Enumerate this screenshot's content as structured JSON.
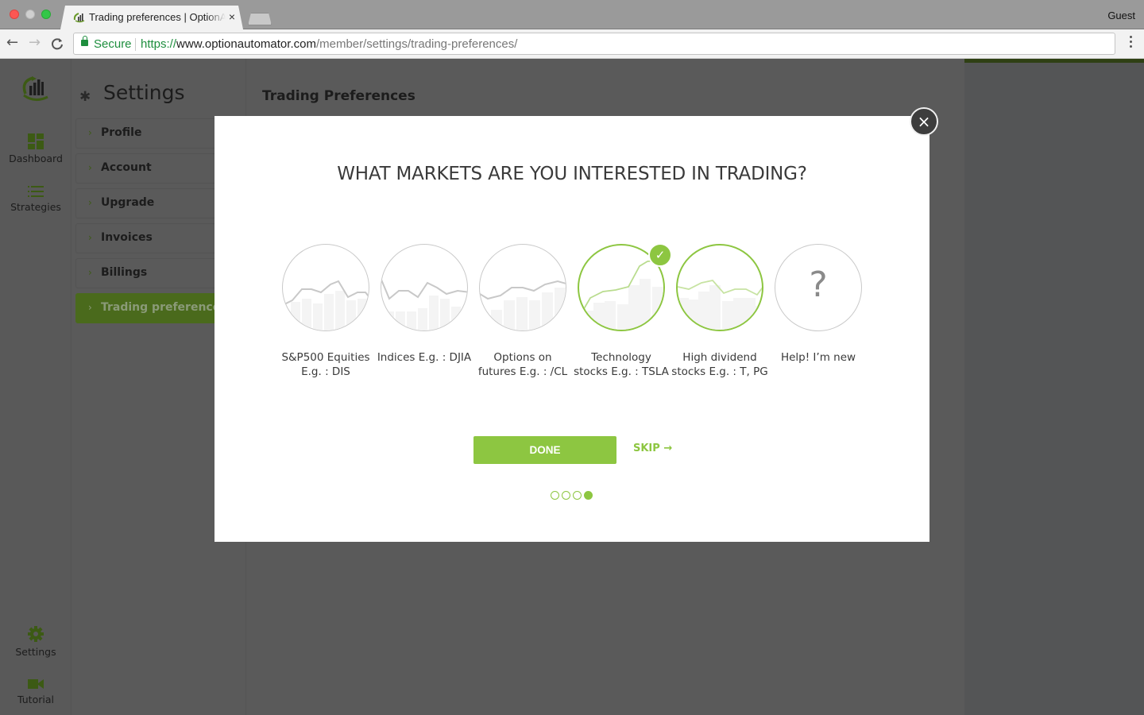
{
  "browser": {
    "tab_title": "Trading preferences | OptionAutomator",
    "tab_close": "×",
    "profile": "Guest",
    "secure_label": "Secure",
    "url": {
      "scheme": "https://",
      "host": "www.optionautomator.com",
      "path": "/member/settings/trading-preferences/"
    },
    "nav": {
      "back": "←",
      "forward": "→",
      "reload": "C"
    }
  },
  "left_nav": {
    "items": [
      {
        "label": "Dashboard",
        "icon": "dashboard-icon"
      },
      {
        "label": "Strategies",
        "icon": "list-icon"
      },
      {
        "label": "Settings",
        "icon": "gear-icon"
      },
      {
        "label": "Tutorial",
        "icon": "video-camera-icon"
      }
    ]
  },
  "settings": {
    "title": "Settings",
    "gear": "✱",
    "chevron": "›",
    "menu": [
      {
        "label": "Profile",
        "active": false
      },
      {
        "label": "Account",
        "active": false
      },
      {
        "label": "Upgrade",
        "active": false
      },
      {
        "label": "Invoices",
        "active": false
      },
      {
        "label": "Billings",
        "active": false
      },
      {
        "label": "Trading preferences",
        "active": true
      }
    ]
  },
  "main": {
    "title": "Trading Preferences"
  },
  "modal": {
    "close": "×",
    "title": "WHAT MARKETS ARE YOU INTERESTED IN TRADING?",
    "check": "✓",
    "help_symbol": "?",
    "markets": [
      {
        "line1": "S&P500 Equities",
        "line2": "E.g. : DIS",
        "selected": false
      },
      {
        "line1": "Indices E.g. : DJIA",
        "line2": "",
        "selected": false
      },
      {
        "line1": "Options on",
        "line2": "futures E.g. : /CL",
        "selected": false
      },
      {
        "line1": "Technology",
        "line2": "stocks E.g. : TSLA",
        "selected": true
      },
      {
        "line1": "High dividend",
        "line2": "stocks E.g. : T, PG",
        "selected": false,
        "highlighted": true
      },
      {
        "line1": "Help! I’m new",
        "line2": "",
        "selected": false
      }
    ],
    "done_label": "DONE",
    "skip_label": "SKIP →",
    "pager": {
      "total": 4,
      "current": 4
    }
  },
  "colors": {
    "accent": "#8dc641",
    "dark_green": "#3c5a14",
    "active_menu": "#4a6a1c"
  }
}
